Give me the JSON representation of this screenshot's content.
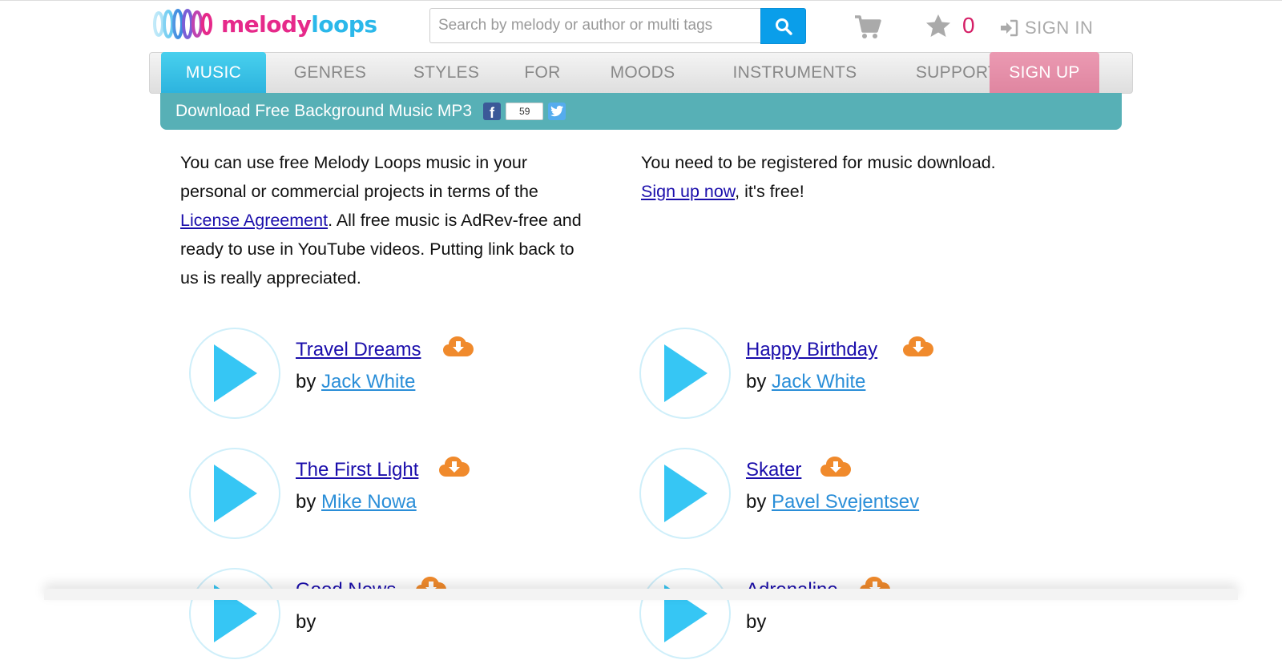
{
  "brand": {
    "part1": "melody",
    "part2": "loops"
  },
  "search": {
    "placeholder": "Search by melody or author or multi tags"
  },
  "header": {
    "favorites_count": "0",
    "signin_label": "SIGN IN"
  },
  "nav": {
    "items": [
      {
        "label": "MUSIC"
      },
      {
        "label": "GENRES"
      },
      {
        "label": "STYLES"
      },
      {
        "label": "FOR"
      },
      {
        "label": "MOODS"
      },
      {
        "label": "INSTRUMENTS"
      },
      {
        "label": "SUPPORT"
      },
      {
        "label": "SIGN UP"
      }
    ]
  },
  "banner": {
    "title": "Download Free Background Music MP3",
    "fb_letter": "f",
    "share_count": "59"
  },
  "intro": {
    "left_part1": "You can use free Melody Loops music in your personal or commercial projects in terms of the ",
    "left_link": "License Agreement",
    "left_part2": ". All free music is AdRev-free and ready to use in YouTube videos. Putting link back to us is really appreciated.",
    "right_part1": "You need to be registered for music download.",
    "right_link": "Sign up now",
    "right_part2": ", it's free!"
  },
  "tracks": [
    {
      "title": "Travel Dreams",
      "by": "by ",
      "author": "Jack White"
    },
    {
      "title": "Happy Birthday",
      "by": "by ",
      "author": "Jack White"
    },
    {
      "title": "The First Light",
      "by": "by ",
      "author": "Mike Nowa"
    },
    {
      "title": "Skater",
      "by": "by ",
      "author": "Pavel Svejentsev"
    },
    {
      "title": "Good News",
      "by": "by ",
      "author": ""
    },
    {
      "title": "Adrenaline",
      "by": "by ",
      "author": ""
    }
  ],
  "colors": {
    "brand_pink": "#e6298a",
    "brand_blue": "#2bb8ea",
    "accent_teal": "#57b0b6",
    "play_blue": "#36c6f4",
    "download_orange": "#f08a2c"
  }
}
